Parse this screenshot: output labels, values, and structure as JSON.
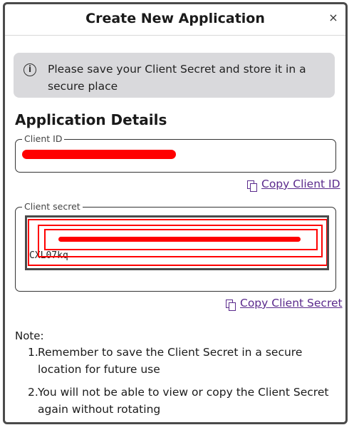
{
  "dialog": {
    "title": "Create New Application",
    "close_symbol": "×"
  },
  "alert": {
    "icon": "info-icon",
    "icon_glyph": "i",
    "message": "Please save your Client Secret and store it in a secure place"
  },
  "section": {
    "title": "Application Details"
  },
  "client_id": {
    "label": "Client ID",
    "value_redacted": true,
    "copy_label": "Copy Client ID",
    "copy_icon": "copy-icon"
  },
  "client_secret": {
    "label": "Client secret",
    "value_redacted": true,
    "visible_tail": "CXL07kq",
    "copy_label": "Copy Client Secret",
    "copy_icon": "copy-icon"
  },
  "notes": {
    "label": "Note:",
    "items": [
      {
        "num": "1.",
        "text": "Remember to save the Client Secret in a secure location for future use"
      },
      {
        "num": "2.",
        "text": "You will not be able to view or copy the Client Secret again without rotating"
      }
    ]
  },
  "colors": {
    "link": "#5a2a8c",
    "alert_bg": "#d9d9dc",
    "redaction": "#ff0000"
  }
}
